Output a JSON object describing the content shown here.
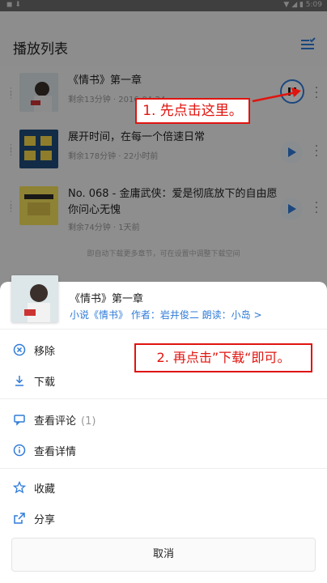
{
  "status_bar": {
    "left": "◼  ⬇",
    "right": "▼ ◢ ▮ 5:09"
  },
  "header": {
    "title": "播放列表"
  },
  "playlist": [
    {
      "title": "《情书》第一章",
      "meta": "剩余13分钟 · 2016-04-24"
    },
    {
      "title": "展开时间，在每一个倍速日常",
      "meta": "剩余178分钟 · 22小时前"
    },
    {
      "title": "No. 068 - 金庸武侠：爱是彻底放下的自由愿你问心无愧",
      "meta": "剩余74分钟 · 1天前"
    }
  ],
  "auto_hint": "即自动下载更多章节，可在设置中调整下载空间",
  "annotations": {
    "step1": "1. 先点击这里。",
    "step2": "2. 再点击”下载“即可。"
  },
  "sheet": {
    "title": "《情书》第一章",
    "subtitle": "小说《情书》 作者：岩井俊二 朗读：小岛 >",
    "menu": [
      {
        "label": "移除",
        "icon": "remove-circle-icon"
      },
      {
        "label": "下载",
        "icon": "download-icon"
      },
      {
        "label": "查看评论",
        "count": "(1)",
        "icon": "comment-icon"
      },
      {
        "label": "查看详情",
        "icon": "info-icon"
      },
      {
        "label": "收藏",
        "icon": "star-icon"
      },
      {
        "label": "分享",
        "icon": "share-icon"
      }
    ],
    "cancel": "取消"
  },
  "colors": {
    "accent": "#2f7bd9",
    "annotation": "#e0140f"
  }
}
